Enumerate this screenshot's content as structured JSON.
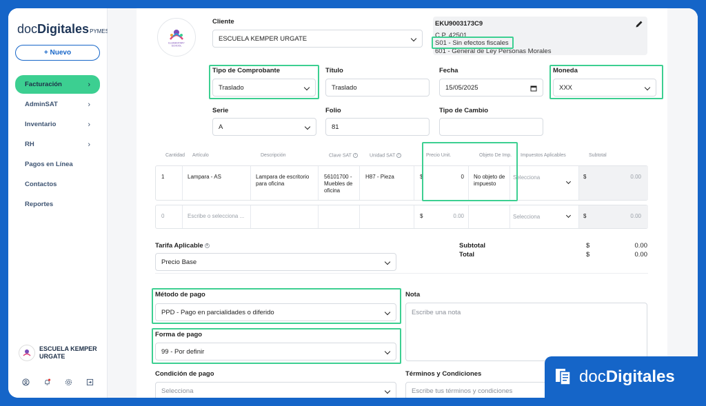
{
  "sidebar": {
    "logo_doc": "doc",
    "logo_digitales": "Digitales",
    "logo_pymes": "PYMES",
    "new_button": "+ Nuevo",
    "items": [
      {
        "label": "Facturación",
        "chevron": "›"
      },
      {
        "label": "AdminSAT",
        "chevron": "›"
      },
      {
        "label": "Inventario",
        "chevron": "›"
      },
      {
        "label": "RH",
        "chevron": "›"
      },
      {
        "label": "Pagos en Línea",
        "chevron": ""
      },
      {
        "label": "Contactos",
        "chevron": ""
      },
      {
        "label": "Reportes",
        "chevron": ""
      }
    ],
    "active_item": "Facturación",
    "user_name": "ESCUELA KEMPER URGATE",
    "bottom_icons": [
      "user-circle-icon",
      "bell-icon",
      "gear-icon",
      "logout-icon"
    ]
  },
  "form": {
    "cliente_label": "Cliente",
    "cliente_value": "ESCUELA KEMPER URGATE",
    "rfc": "EKU9003173C9",
    "cp": "C.P. 42501",
    "uso": "S01 - Sin efectos fiscales",
    "regimen": "601 - General de Ley Personas Morales",
    "tipo_label": "Tipo de Comprobante",
    "tipo_value": "Traslado",
    "titulo_label": "Título",
    "titulo_value": "Traslado",
    "fecha_label": "Fecha",
    "fecha_value": "15/05/2025",
    "moneda_label": "Moneda",
    "moneda_value": "XXX",
    "serie_label": "Serie",
    "serie_value": "A",
    "folio_label": "Folio",
    "folio_value": "81",
    "tipo_cambio_label": "Tipo de Cambio",
    "tipo_cambio_value": ""
  },
  "table": {
    "headers": [
      "Cantidad",
      "Artículo",
      "Descripción",
      "Clave SAT",
      "Unidad SAT",
      "Precio Unit.",
      "Objeto De Imp.",
      "Impuestos Aplicables",
      "Subtotal"
    ],
    "row1": {
      "cantidad": "1",
      "articulo": "Lampara - AS",
      "descripcion": "Lampara de escritorio para oficina",
      "clave": "56101700 - Muebles de oficina",
      "unidad": "H87 - Pieza",
      "precio_sym": "$",
      "precio": "0",
      "objeto": "No objeto de impuesto",
      "impuestos": "Selecciona",
      "subtotal_sym": "$",
      "subtotal": "0.00"
    },
    "row2": {
      "cantidad": "0",
      "articulo": "Escribe o selecciona ...",
      "precio_sym": "$",
      "precio": "0.00",
      "impuestos": "Selecciona",
      "subtotal_sym": "$",
      "subtotal": "0.00"
    }
  },
  "tarifa": {
    "label": "Tarifa Aplicable",
    "value": "Precio Base"
  },
  "totals": {
    "subtotal_label": "Subtotal",
    "total_label": "Total",
    "sym": "$",
    "subtotal": "0.00",
    "total": "0.00"
  },
  "metodo": {
    "label": "Método de pago",
    "value": "PPD - Pago en parcialidades o diferido"
  },
  "forma": {
    "label": "Forma de pago",
    "value": "99 - Por definir"
  },
  "condicion": {
    "label": "Condición de pago",
    "placeholder": "Selecciona"
  },
  "nota": {
    "label": "Nota",
    "placeholder": "Escribe una nota"
  },
  "terminos": {
    "label": "Términos y Condiciones",
    "placeholder": "Escribe tus términos y condiciones"
  },
  "brand": {
    "doc": "doc",
    "digitales": "Digitales"
  },
  "colors": {
    "brand_blue": "#1565c8",
    "accent_green": "#3ccf91",
    "nav_text": "#3e5472"
  }
}
